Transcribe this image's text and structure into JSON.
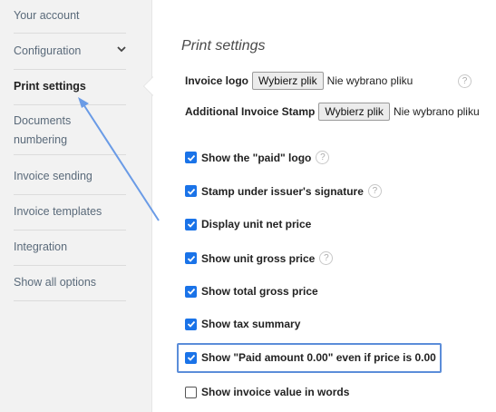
{
  "sidebar": {
    "items": [
      {
        "label": "Your account"
      },
      {
        "label": "Configuration"
      },
      {
        "label": "Print settings"
      },
      {
        "label": "Documents numbering"
      },
      {
        "label": "Invoice sending"
      },
      {
        "label": "Invoice templates"
      },
      {
        "label": "Integration"
      },
      {
        "label": "Show all options"
      }
    ]
  },
  "main": {
    "title": "Print settings",
    "invoice_logo": {
      "label": "Invoice logo",
      "button": "Wybierz plik",
      "status": "Nie wybrano pliku"
    },
    "additional_stamp": {
      "label": "Additional Invoice Stamp",
      "button": "Wybierz plik",
      "status": "Nie wybrano pliku"
    },
    "options": [
      {
        "label": "Show the \"paid\" logo",
        "checked": true
      },
      {
        "label": "Stamp under issuer's signature",
        "checked": true
      },
      {
        "label": "Display unit net price",
        "checked": true
      },
      {
        "label": "Show unit gross price",
        "checked": true
      },
      {
        "label": "Show total gross price",
        "checked": true
      },
      {
        "label": "Show tax summary",
        "checked": true
      },
      {
        "label": "Show \"Paid amount 0.00\" even if price is 0.00",
        "checked": true
      },
      {
        "label": "Show invoice value in words",
        "checked": false
      }
    ],
    "help_glyph": "?"
  },
  "colors": {
    "accent": "#1a73e8",
    "highlight": "#5b8dd9"
  }
}
